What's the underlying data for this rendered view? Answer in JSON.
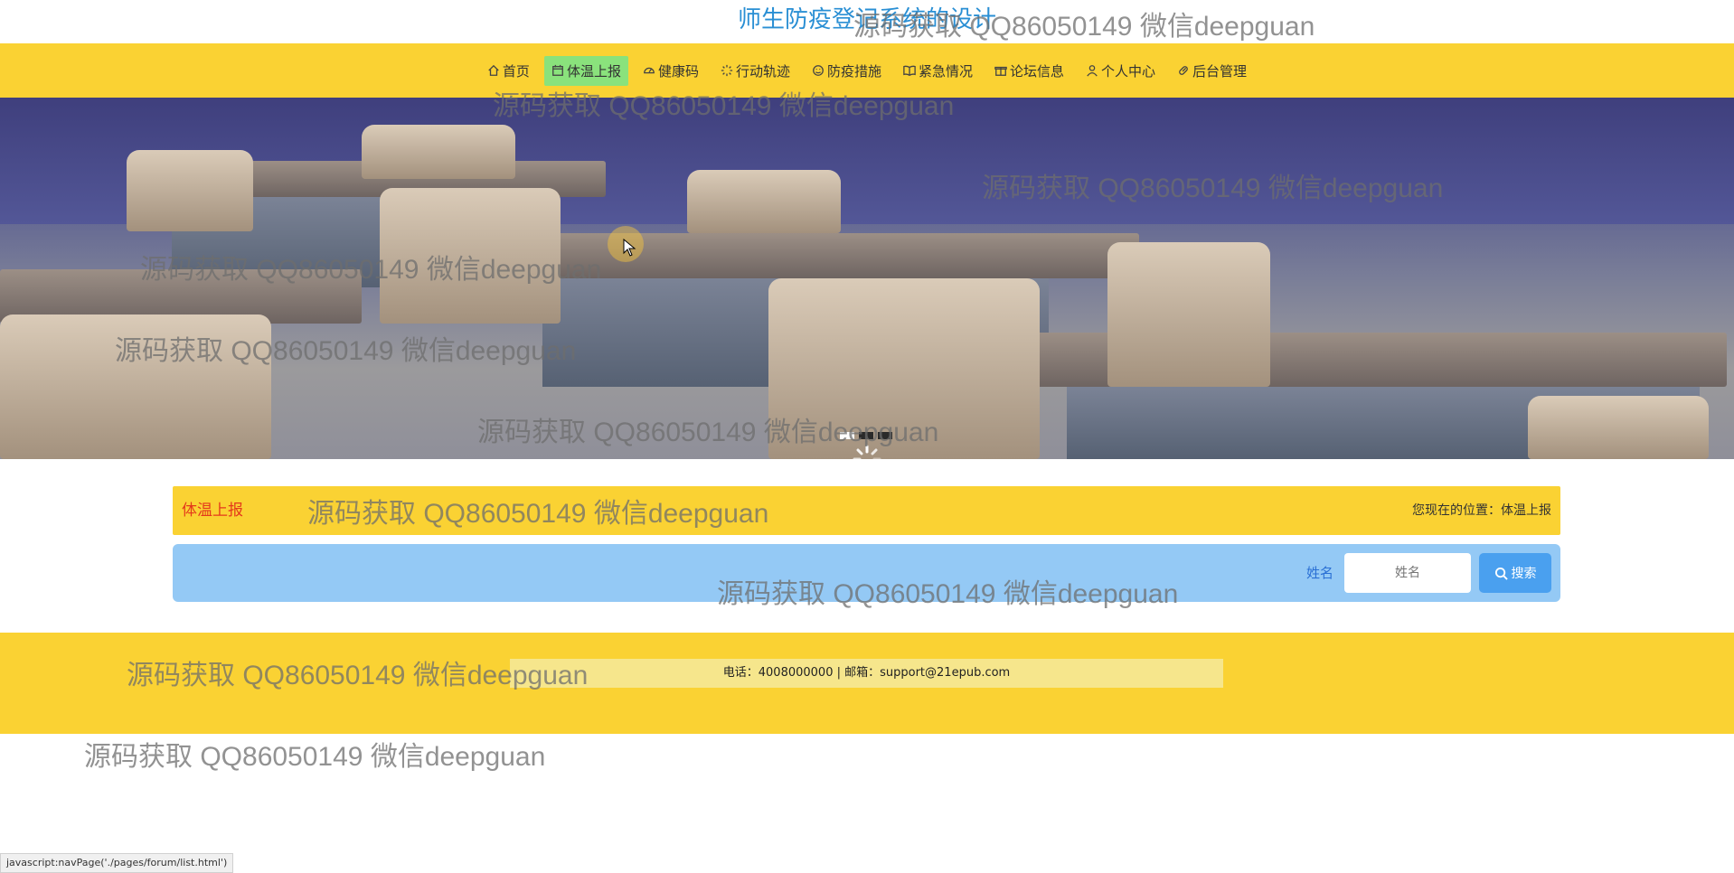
{
  "site": {
    "title": "师生防疫登记系统的设计"
  },
  "nav": {
    "items": [
      {
        "label": "首页",
        "icon": "home-icon",
        "active": false
      },
      {
        "label": "体温上报",
        "icon": "calendar-icon",
        "active": true
      },
      {
        "label": "健康码",
        "icon": "gauge-icon",
        "active": false
      },
      {
        "label": "行动轨迹",
        "icon": "spinner-icon",
        "active": false
      },
      {
        "label": "防疫措施",
        "icon": "smile-icon",
        "active": false
      },
      {
        "label": "紧急情况",
        "icon": "book-icon",
        "active": false
      },
      {
        "label": "论坛信息",
        "icon": "gift-icon",
        "active": false
      },
      {
        "label": "个人中心",
        "icon": "user-icon",
        "active": false
      },
      {
        "label": "后台管理",
        "icon": "link-icon",
        "active": false
      }
    ]
  },
  "banner": {
    "slides": 3,
    "active_slide": 1
  },
  "location": {
    "title": "体温上报",
    "crumb": "您现在的位置：体温上报"
  },
  "search": {
    "label": "姓名",
    "placeholder": "姓名",
    "button_label": "搜索"
  },
  "footer": {
    "info": "电话：4008000000 | 邮箱：support@21epub.com"
  },
  "watermark": {
    "text": "源码获取 QQ86050149 微信deepguan"
  },
  "status_bar": {
    "text": "javascript:navPage('./pages/forum/list.html')"
  },
  "colors": {
    "primary": "#fad233",
    "active_nav": "#8ae27c",
    "search_bg": "#94c9f5",
    "button": "#4aa0ef",
    "title": "#2a8fd4"
  }
}
